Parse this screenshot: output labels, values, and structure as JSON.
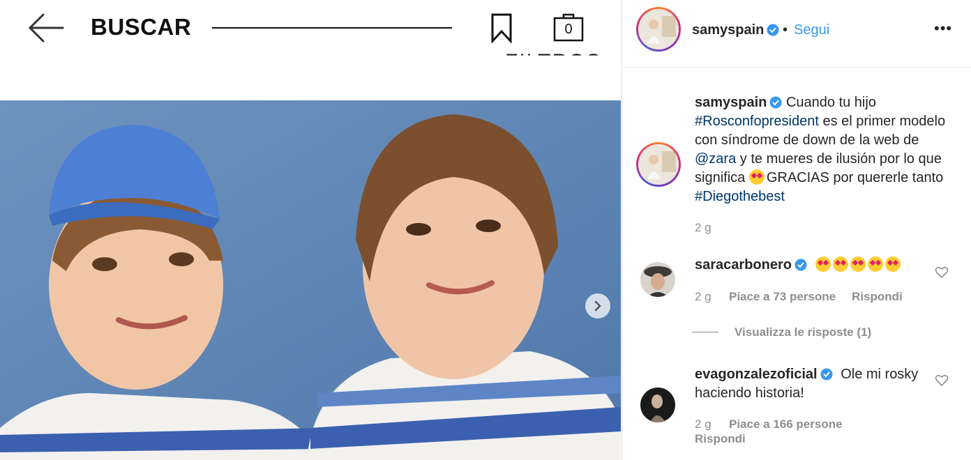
{
  "store": {
    "title": "BUSCAR",
    "bag_count": "0",
    "filters_label": "FILTROS"
  },
  "post": {
    "author": "samyspain",
    "follow_label": "Segui",
    "separator": "•",
    "more_label": "•••",
    "caption": {
      "author": "samyspain",
      "part1": "Cuando tu hijo ",
      "hashtag1": "#Rosconfopresident",
      "part2": " es el primer modelo con síndrome de down de la web de ",
      "mention": "@zara",
      "part3": " y te mueres de ilusión por lo que significa ",
      "part4": "GRACIAS por quererle tanto ",
      "hashtag2": "#Diegothebest",
      "time": "2 g"
    },
    "comments": [
      {
        "author": "saracarbonero",
        "text": "",
        "time": "2 g",
        "likes": "Piace a 73 persone",
        "reply": "Rispondi",
        "view_replies": "Visualizza le risposte (1)"
      },
      {
        "author": "evagonzalezoficial",
        "text": "Ole mi rosky haciendo historia!",
        "time": "2 g",
        "likes": "Piace a 166 persone",
        "reply": "Rispondi"
      }
    ]
  },
  "colors": {
    "accent": "#3897f0",
    "link": "#003569",
    "muted": "#8e8e8e",
    "wall": "#5e86b6"
  },
  "icons": [
    "back-arrow-icon",
    "bookmark-icon",
    "shopping-bag-icon",
    "verified-badge-icon",
    "more-options-icon",
    "heart-icon",
    "chevron-right-icon",
    "heart-eyes-emoji-icon",
    "smiling-emoji-icon"
  ]
}
